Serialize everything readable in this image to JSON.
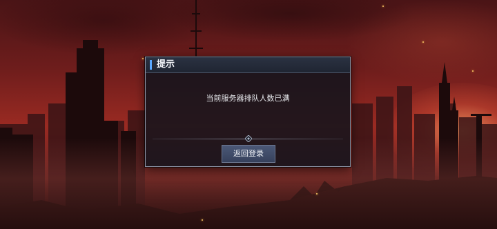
{
  "dialog": {
    "title": "提示",
    "message": "当前服务器排队人数已满",
    "button_label": "返回登录"
  },
  "colors": {
    "accent": "#5aa8ff",
    "sky": "#9a2a22",
    "button": "#3f4b68"
  }
}
